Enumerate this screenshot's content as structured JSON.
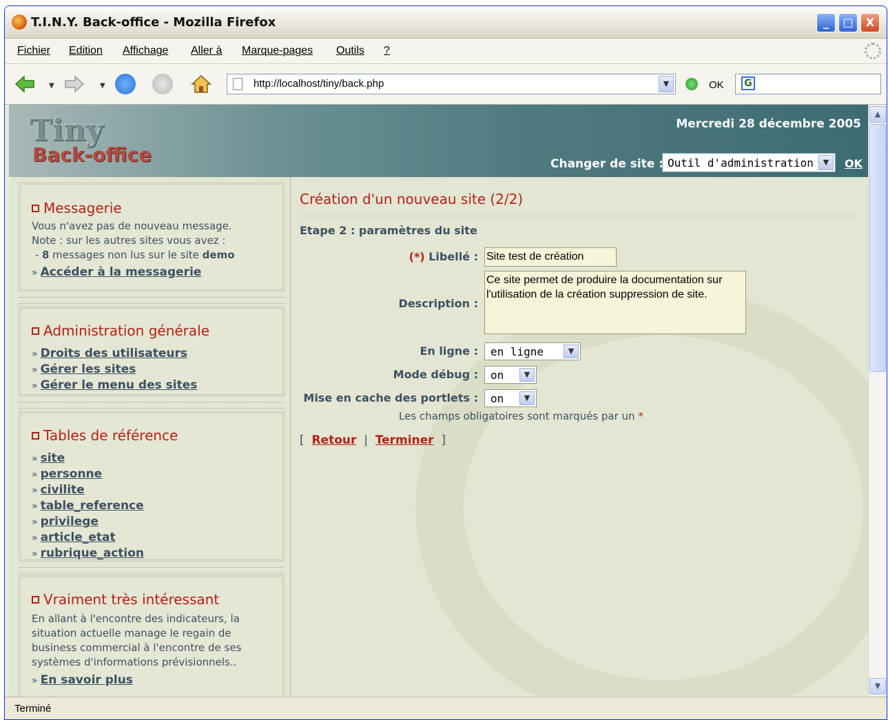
{
  "window": {
    "title": "T.I.N.Y. Back-office - Mozilla Firefox",
    "min_label": "_",
    "max_label": "□",
    "close_label": "X"
  },
  "menu": {
    "items": [
      "Fichier",
      "Edition",
      "Affichage",
      "Aller à",
      "Marque-pages",
      "Outils",
      "?"
    ]
  },
  "nav": {
    "url": "http://localhost/tiny/back.php",
    "go_label": "OK",
    "search_icon_label": "G"
  },
  "header": {
    "logo_main": "Tiny",
    "logo_sub": "Back-office",
    "date": "Mercredi 28 décembre 2005",
    "site_label": "Changer de site :",
    "site_value": "Outil d'administration",
    "ok_label": "OK"
  },
  "sidebar": {
    "messagerie": {
      "title": "Messagerie",
      "line1": "Vous n'avez pas de nouveau message.",
      "line2": "Note : sur les autres sites vous avez :",
      "line3_prefix": " - ",
      "line3_count": "8",
      "line3_mid": " messages non lus sur le site ",
      "line3_site": "demo",
      "link": "Accéder à la messagerie"
    },
    "admin": {
      "title": "Administration générale",
      "links": [
        "Droits des utilisateurs",
        "Gérer les sites",
        "Gérer le menu des sites"
      ]
    },
    "tables": {
      "title": "Tables de référence",
      "links": [
        "site",
        "personne",
        "civilite",
        "table_reference",
        "privilege",
        "article_etat",
        "rubrique_action"
      ]
    },
    "interessant": {
      "title": "Vraiment très intéressant",
      "lines": [
        "En allant à l'encontre des indicateurs, la",
        "situation actuelle manage le regain de",
        "business commercial à l'encontre de ses",
        "systèmes d'informations prévisionnels.."
      ],
      "link": "En savoir plus"
    }
  },
  "main": {
    "title": "Création d'un nouveau site (2/2)",
    "step": "Etape 2 : paramètres du site",
    "fields": {
      "libelle_req": "(*)",
      "libelle_label": "Libellé :",
      "libelle_value": "Site test de création",
      "description_label": "Description :",
      "description_value": "Ce site permet de produire la documentation sur l'utilisation de la création suppression de site.",
      "en_ligne_label": "En ligne :",
      "en_ligne_value": "en ligne",
      "mode_debug_label": "Mode débug :",
      "mode_debug_value": "on",
      "cache_label": "Mise en cache des portlets :",
      "cache_value": "on"
    },
    "note": "Les champs obligatoires sont marqués par un",
    "note_star": "*",
    "actions": {
      "open": "[",
      "retour": "Retour",
      "sep": "|",
      "terminer": "Terminer",
      "close": "]"
    }
  },
  "status": {
    "text": "Terminé"
  }
}
